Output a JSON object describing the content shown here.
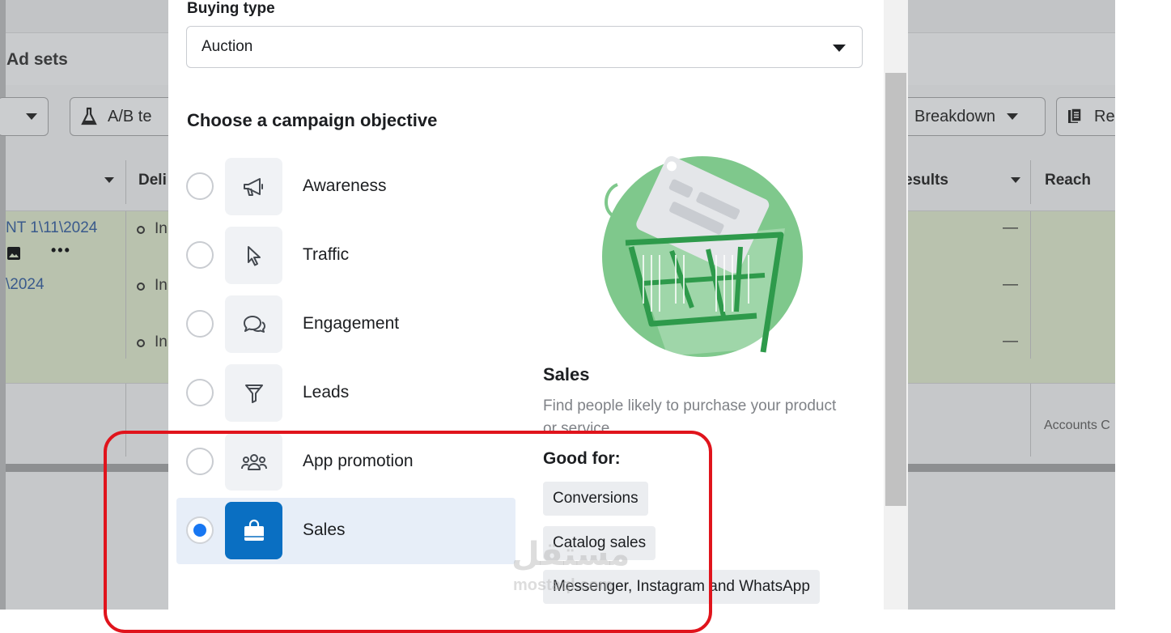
{
  "background": {
    "section_title": "Ad sets",
    "toolbar": {
      "ab_test_label": "A/B te",
      "breakdown_label": "Breakdown",
      "reports_label": "Re"
    },
    "columns": {
      "delivery": "Deli",
      "results": "esults",
      "reach": "Reach"
    },
    "rows": [
      {
        "name": "NT 1\\11\\2024",
        "status": "In",
        "result": "—"
      },
      {
        "name": "\\2024",
        "status": "In",
        "result": "—"
      },
      {
        "name": "",
        "status": "In",
        "result": "—"
      }
    ],
    "footer_text": "Accounts C"
  },
  "modal": {
    "buying_type_label": "Buying type",
    "buying_type_value": "Auction",
    "objective_heading": "Choose a campaign objective",
    "objectives": [
      {
        "label": "Awareness",
        "icon": "megaphone-icon",
        "selected": false
      },
      {
        "label": "Traffic",
        "icon": "cursor-icon",
        "selected": false
      },
      {
        "label": "Engagement",
        "icon": "chat-bubbles-icon",
        "selected": false
      },
      {
        "label": "Leads",
        "icon": "funnel-icon",
        "selected": false
      },
      {
        "label": "App promotion",
        "icon": "people-icon",
        "selected": false
      },
      {
        "label": "Sales",
        "icon": "shopping-bag-icon",
        "selected": true
      }
    ],
    "details": {
      "title": "Sales",
      "description": "Find people likely to purchase your product or service.",
      "good_for_label": "Good for:",
      "chips": [
        "Conversions",
        "Catalog sales",
        "Messenger, Instagram and WhatsApp"
      ]
    }
  },
  "colors": {
    "accent": "#1877f2",
    "selected_tile": "#0a6fc2",
    "selected_row": "#e7eef8",
    "annotation": "#e0141c",
    "illustration_green": "#7fc88c"
  },
  "watermark": {
    "text": "مستقل",
    "sub": "mostaql.com"
  }
}
